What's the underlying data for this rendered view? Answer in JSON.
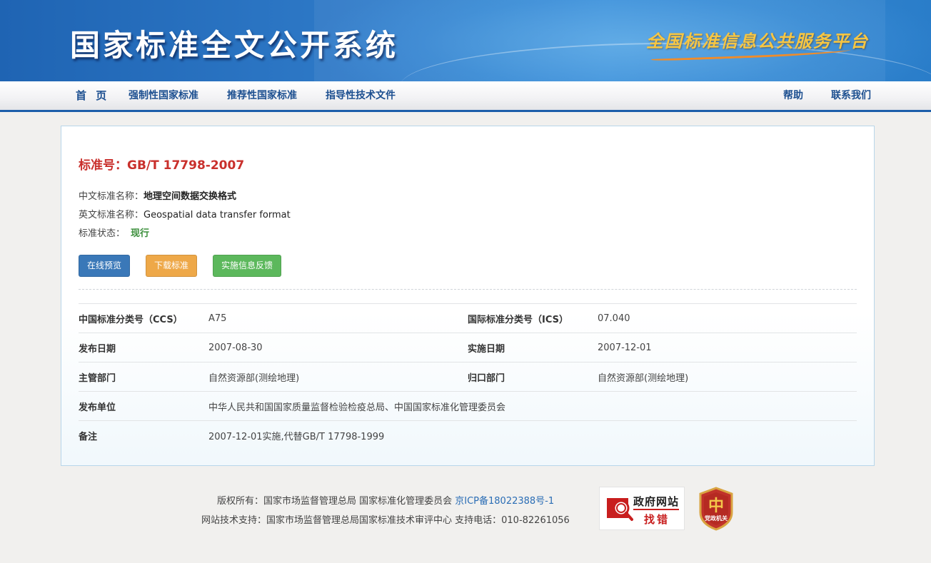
{
  "header": {
    "site_title": "国家标准全文公开系统",
    "slogan": "全国标准信息公共服务平台"
  },
  "nav": {
    "home": "首 页",
    "mandatory": "强制性国家标准",
    "recommended": "推荐性国家标准",
    "guidance": "指导性技术文件",
    "help": "帮助",
    "contact": "联系我们"
  },
  "standard": {
    "number_label": "标准号：",
    "number": "GB/T 17798-2007",
    "cn_name_label": "中文标准名称：",
    "cn_name": "地理空间数据交换格式",
    "en_name_label": "英文标准名称：",
    "en_name": "Geospatial data transfer format",
    "status_label": "标准状态：",
    "status": "现行"
  },
  "actions": {
    "preview": "在线预览",
    "download": "下载标准",
    "feedback": "实施信息反馈"
  },
  "details": {
    "ccs_label": "中国标准分类号（CCS）",
    "ccs": "A75",
    "ics_label": "国际标准分类号（ICS）",
    "ics": "07.040",
    "publish_date_label": "发布日期",
    "publish_date": "2007-08-30",
    "impl_date_label": "实施日期",
    "impl_date": "2007-12-01",
    "dept_label": "主管部门",
    "dept": "自然资源部(测绘地理)",
    "central_dept_label": "归口部门",
    "central_dept": "自然资源部(测绘地理)",
    "issuer_label": "发布单位",
    "issuer": "中华人民共和国国家质量监督检验检疫总局、中国国家标准化管理委员会",
    "remark_label": "备注",
    "remark": "2007-12-01实施,代替GB/T 17798-1999"
  },
  "footer": {
    "copyright": "版权所有：国家市场监督管理总局 国家标准化管理委员会 ",
    "icp": "京ICP备18022388号-1",
    "support": "网站技术支持：国家市场监督管理总局国家标准技术审评中心 支持电话：010-82261056",
    "gov_badge_top": "政府网站",
    "gov_badge_bottom": "找错",
    "party_badge": "党政机关"
  },
  "colors": {
    "brand_blue": "#1c5eaa",
    "std_red": "#c9302c",
    "status_green": "#3c8f3c",
    "btn_primary": "#3a78b8",
    "btn_warning": "#eea848",
    "btn_success": "#5cb85c"
  }
}
